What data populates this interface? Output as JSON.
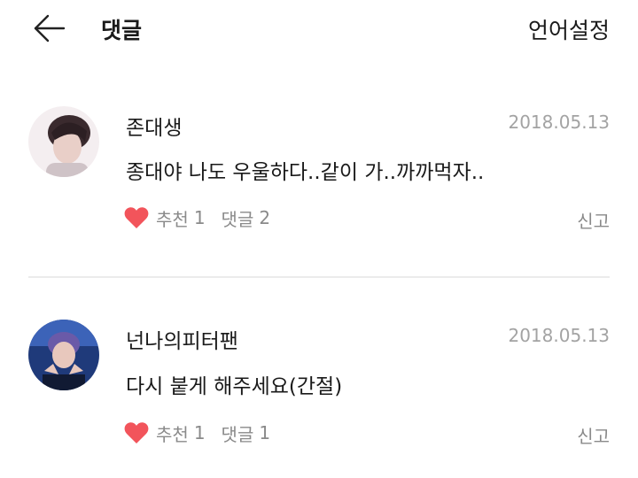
{
  "header": {
    "title": "댓글",
    "language_button": "언어설정",
    "back_icon": "arrow-left-icon"
  },
  "comments": [
    {
      "username": "존대생",
      "date": "2018.05.13",
      "content": "종대야 나도 우울하다..같이 가..까까먹자..",
      "like_label": "추천",
      "like_count": "1",
      "reply_label": "댓글",
      "reply_count": "2",
      "report_label": "신고",
      "heart_color": "#f2545b"
    },
    {
      "username": "넌나의피터팬",
      "date": "2018.05.13",
      "content": "다시 붙게 해주세요(간절)",
      "like_label": "추천",
      "like_count": "1",
      "reply_label": "댓글",
      "reply_count": "1",
      "report_label": "신고",
      "heart_color": "#f2545b"
    }
  ]
}
